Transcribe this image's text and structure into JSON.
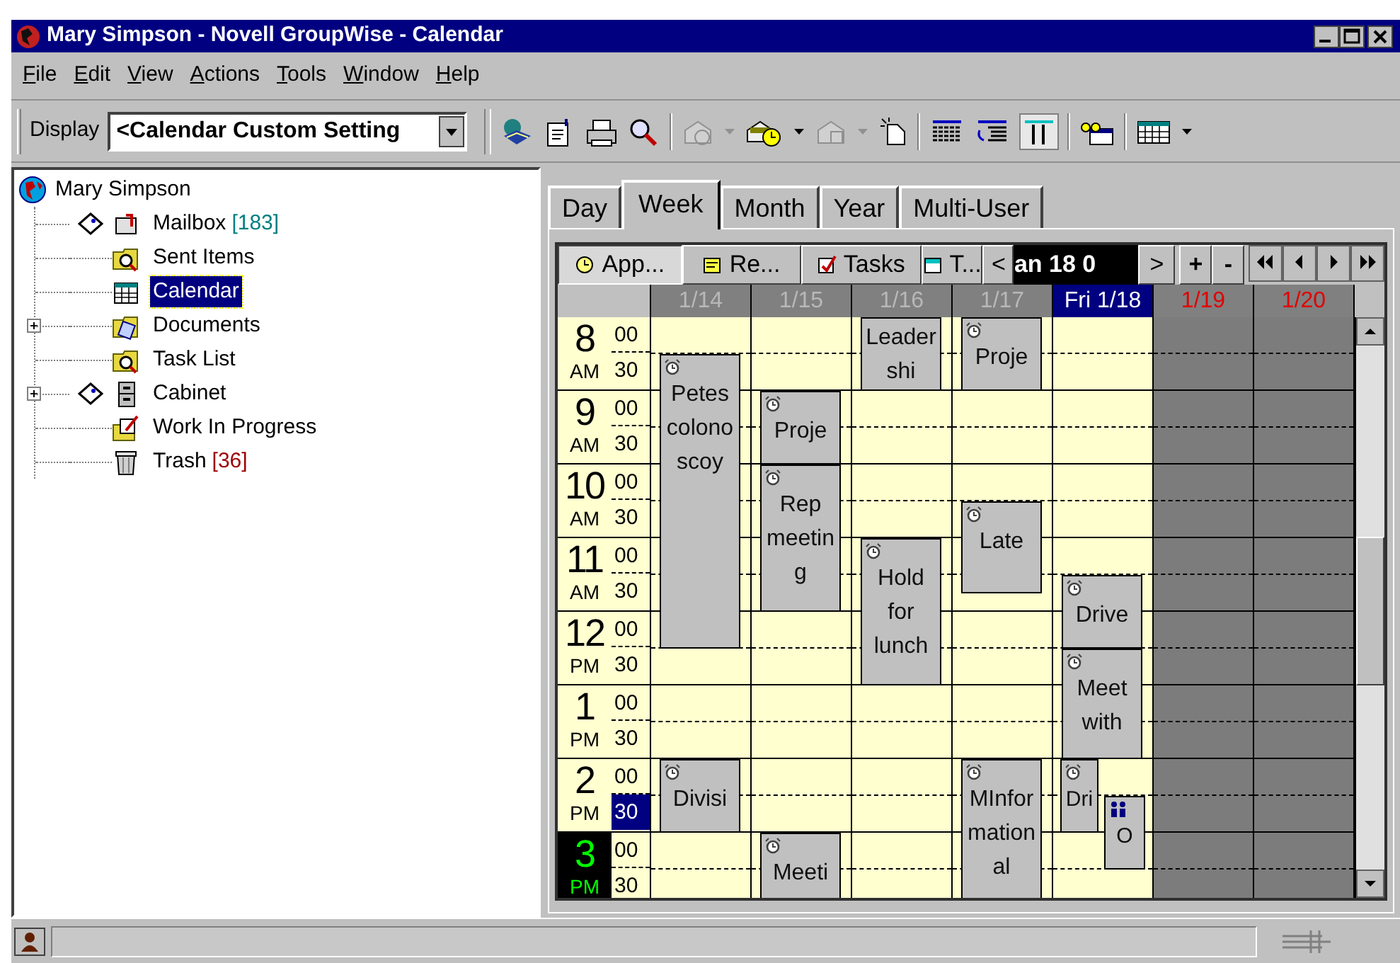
{
  "window": {
    "title": "Mary Simpson - Novell GroupWise - Calendar"
  },
  "menu": [
    "File",
    "Edit",
    "View",
    "Actions",
    "Tools",
    "Window",
    "Help"
  ],
  "toolbar": {
    "display_label": "Display",
    "display_value": "<Calendar Custom Setting"
  },
  "folder_tree": {
    "label": "Mary Simpson",
    "children": [
      {
        "label": "Mailbox",
        "count": "[183]",
        "color": "#008080",
        "kind": "mailbox",
        "shared": true,
        "selected": false
      },
      {
        "label": "Sent Items",
        "kind": "query",
        "shared": false,
        "selected": false
      },
      {
        "label": "Calendar",
        "kind": "calendar",
        "shared": false,
        "selected": true
      },
      {
        "label": "Documents",
        "kind": "documents",
        "shared": false,
        "expanded": false,
        "selected": false
      },
      {
        "label": "Task List",
        "kind": "query",
        "shared": false,
        "selected": false
      },
      {
        "label": "Cabinet",
        "kind": "cabinet",
        "shared": true,
        "expanded": false,
        "selected": false
      },
      {
        "label": "Work In Progress",
        "kind": "work",
        "shared": false,
        "selected": false
      },
      {
        "label": "Trash",
        "count": "[36]",
        "color": "#a00000",
        "kind": "trash",
        "shared": false,
        "selected": false
      }
    ]
  },
  "view_tabs": [
    {
      "label": "Day",
      "selected": false
    },
    {
      "label": "Week",
      "selected": true
    },
    {
      "label": "Month",
      "selected": false
    },
    {
      "label": "Year",
      "selected": false
    },
    {
      "label": "Multi-User",
      "selected": false
    }
  ],
  "calendar": {
    "filters": [
      {
        "label": "App...",
        "kind": "appointments",
        "selected": true
      },
      {
        "label": "Re...",
        "kind": "reminders",
        "selected": false
      },
      {
        "label": "Tasks",
        "kind": "tasks",
        "selected": false
      },
      {
        "label": "T...",
        "kind": "calendar",
        "selected": false
      }
    ],
    "date_nav": {
      "previous": "<",
      "date": "an 18 0",
      "next": ">",
      "zoom_in": "+",
      "zoom_out": "-"
    },
    "days": [
      {
        "label": "1/14",
        "selected": false,
        "weekend": false,
        "appointments": [
          {
            "text": "Petes colonoscoy",
            "kind": "alarm"
          },
          {
            "text": "Divisi",
            "kind": "alarm"
          }
        ]
      },
      {
        "label": "1/15",
        "selected": false,
        "weekend": false,
        "appointments": [
          {
            "text": "Proje",
            "kind": "alarm"
          },
          {
            "text": "Rep meeting",
            "kind": "alarm"
          },
          {
            "text": "Meeti",
            "kind": "alarm"
          }
        ]
      },
      {
        "label": "1/16",
        "selected": false,
        "weekend": false,
        "appointments": [
          {
            "text": "Leadershi",
            "kind": "plain"
          },
          {
            "text": "Hold for lunch",
            "kind": "alarm"
          }
        ]
      },
      {
        "label": "1/17",
        "selected": false,
        "weekend": false,
        "appointments": [
          {
            "text": "Proje",
            "kind": "alarm"
          },
          {
            "text": "Late",
            "kind": "alarm"
          },
          {
            "text": "MInformational",
            "kind": "alarm"
          }
        ]
      },
      {
        "label": "Fri 1/18",
        "selected": true,
        "weekend": false,
        "appointments": [
          {
            "text": "Drive",
            "kind": "alarm"
          },
          {
            "text": "Meet with",
            "kind": "alarm"
          },
          {
            "text": "Dri",
            "kind": "alarm"
          },
          {
            "text": "O",
            "kind": "group"
          }
        ]
      },
      {
        "label": "1/19",
        "selected": false,
        "weekend": true
      },
      {
        "label": "1/20",
        "selected": false,
        "weekend": true
      }
    ],
    "hours": [
      {
        "hour": "8",
        "meridiem": "AM",
        "current": false,
        "slots": [
          {
            "label": "00",
            "selected": false
          },
          {
            "label": "30",
            "selected": false
          }
        ]
      },
      {
        "hour": "9",
        "meridiem": "AM",
        "current": false,
        "slots": [
          {
            "label": "00",
            "selected": false
          },
          {
            "label": "30",
            "selected": false
          }
        ]
      },
      {
        "hour": "10",
        "meridiem": "AM",
        "current": false,
        "slots": [
          {
            "label": "00",
            "selected": false
          },
          {
            "label": "30",
            "selected": false
          }
        ]
      },
      {
        "hour": "11",
        "meridiem": "AM",
        "current": false,
        "slots": [
          {
            "label": "00",
            "selected": false
          },
          {
            "label": "30",
            "selected": false
          }
        ]
      },
      {
        "hour": "12",
        "meridiem": "PM",
        "current": false,
        "slots": [
          {
            "label": "00",
            "selected": false
          },
          {
            "label": "30",
            "selected": false
          }
        ]
      },
      {
        "hour": "1",
        "meridiem": "PM",
        "current": false,
        "slots": [
          {
            "label": "00",
            "selected": false
          },
          {
            "label": "30",
            "selected": false
          }
        ]
      },
      {
        "hour": "2",
        "meridiem": "PM",
        "current": false,
        "slots": [
          {
            "label": "00",
            "selected": false
          },
          {
            "label": "30",
            "selected": true
          }
        ]
      },
      {
        "hour": "3",
        "meridiem": "PM",
        "current": true,
        "slots": [
          {
            "label": "00",
            "selected": false
          },
          {
            "label": "30",
            "selected": false
          }
        ]
      }
    ]
  }
}
